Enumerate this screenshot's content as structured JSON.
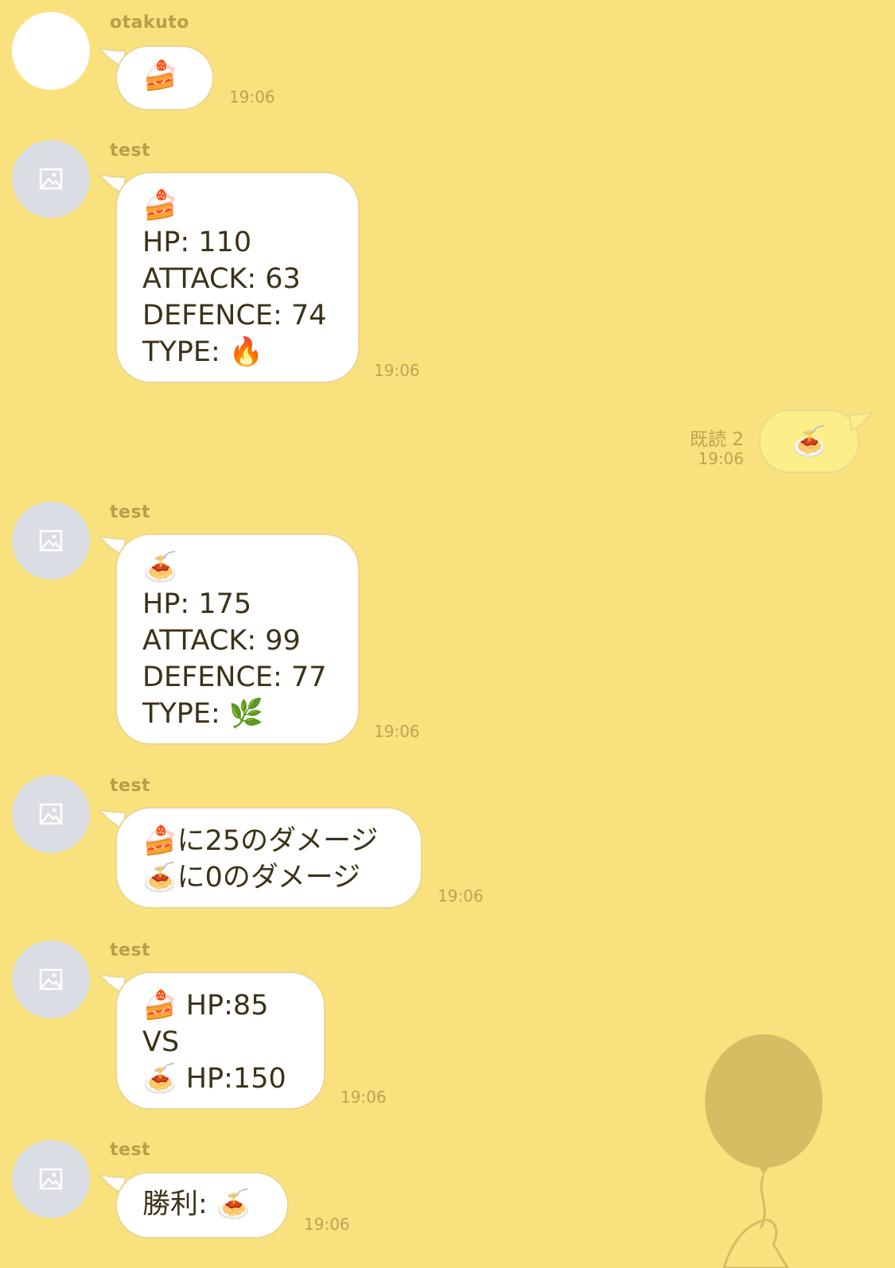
{
  "messages": [
    {
      "sender": "otakuto",
      "lines": [
        "🍰"
      ],
      "time": "19:06"
    },
    {
      "sender": "test",
      "lines": [
        "🍰",
        "HP: 110",
        "ATTACK: 63",
        "DEFENCE: 74",
        "TYPE: 🔥"
      ],
      "time": "19:06"
    },
    {
      "sender": "test",
      "lines": [
        "🍝",
        "HP: 175",
        "ATTACK: 99",
        "DEFENCE: 77",
        "TYPE: 🌿"
      ],
      "time": "19:06"
    },
    {
      "sender": "test",
      "lines": [
        "🍰に25のダメージ",
        "🍝に0のダメージ"
      ],
      "time": "19:06"
    },
    {
      "sender": "test",
      "lines": [
        "🍰 HP:85",
        "VS",
        "🍝 HP:150"
      ],
      "time": "19:06"
    },
    {
      "sender": "test",
      "lines": [
        "勝利: 🍝"
      ],
      "time": "19:06"
    }
  ],
  "outgoing": {
    "text": "🍝",
    "read": "既読 2",
    "time": "19:06"
  },
  "colors": {
    "background": "#f9e27e",
    "incoming_bubble": "#ffffff",
    "outgoing_bubble": "#fcef8a",
    "text": "#3b3218"
  },
  "icons": {
    "avatar": "image-placeholder-icon",
    "decoration": "balloon-icon"
  }
}
